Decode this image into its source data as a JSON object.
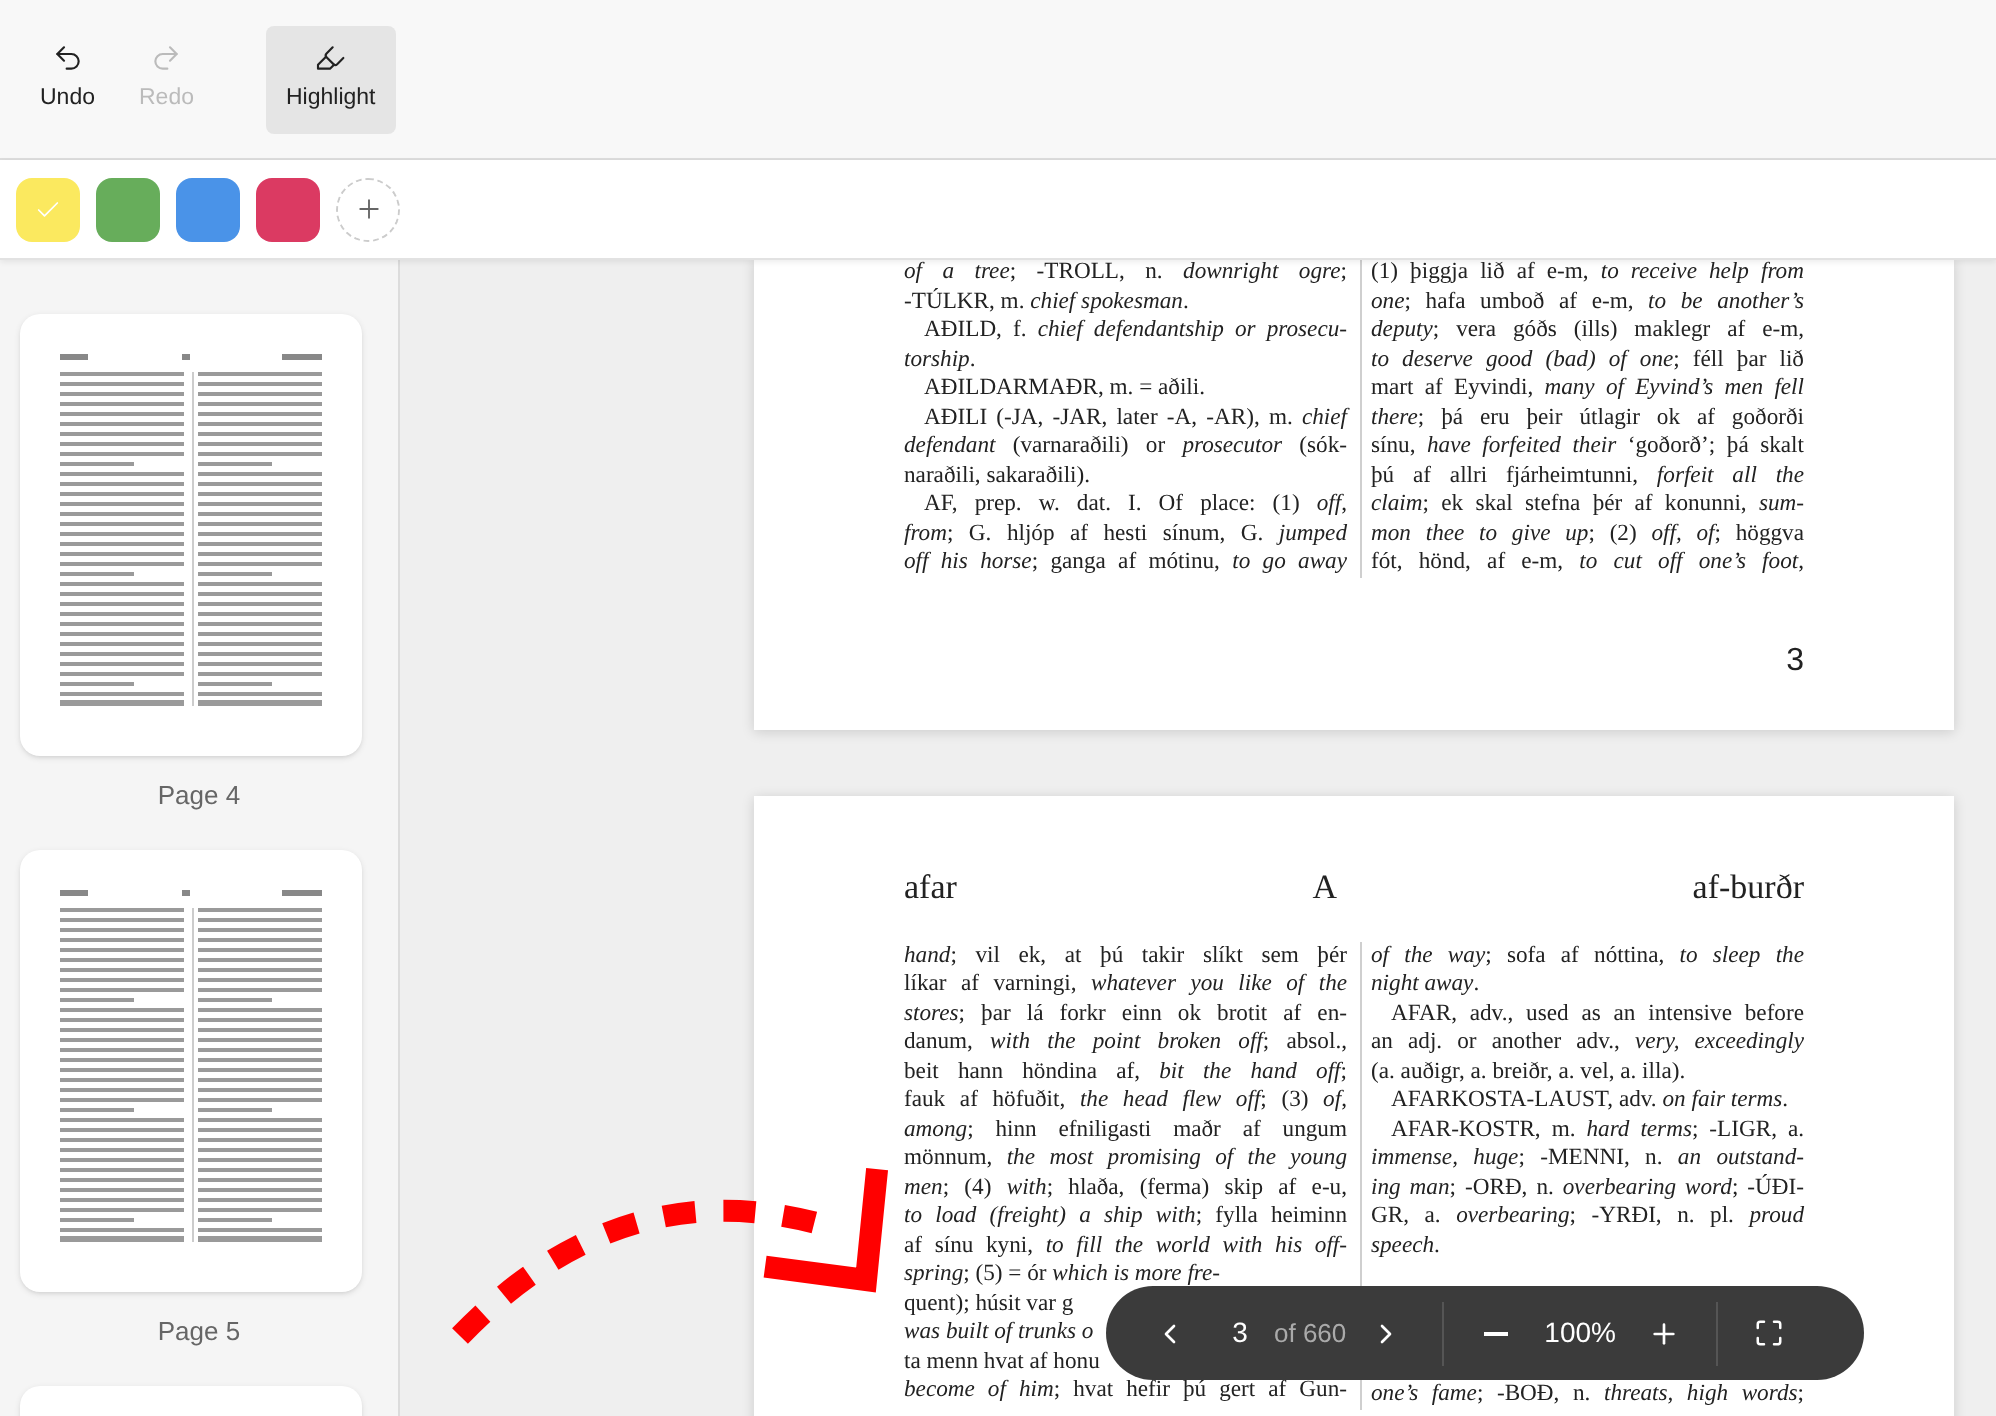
{
  "toolbar": {
    "buttons": [
      {
        "label": "Undo",
        "kind": "undo",
        "disabled": false,
        "selected": false
      },
      {
        "label": "Redo",
        "kind": "redo",
        "disabled": true,
        "selected": false
      },
      {
        "label": "Highlight",
        "kind": "highlight",
        "disabled": false,
        "selected": true
      }
    ]
  },
  "palette": {
    "colors": [
      {
        "color": "#fbe95f",
        "selected": true
      },
      {
        "color": "#67ad5b",
        "selected": false
      },
      {
        "color": "#4a93e8",
        "selected": false
      },
      {
        "color": "#db3a62",
        "selected": false
      }
    ]
  },
  "sidebar": {
    "thumbnails": [
      {
        "label": "Page 4"
      },
      {
        "label": "Page 5"
      }
    ]
  },
  "pages": [
    {
      "page_number": "3",
      "columns": [
        [
          {
            "text": "*of a tree*; -TROLL, n. *downright ogre*;",
            "kind": "line"
          },
          {
            "text": "-TÚLKR, m. *chief spokesman*.",
            "kind": "last"
          },
          {
            "text": "AÐILD, f. *chief defendantship or prosecu-*",
            "kind": "first"
          },
          {
            "text": "*torship*.",
            "kind": "last"
          },
          {
            "text": "AÐILDARMAÐR, m. = aðili.",
            "kind": "single"
          },
          {
            "text": "AÐILI (-JA, -JAR, later -A, -AR), m. *chief*",
            "kind": "first"
          },
          {
            "text": "*defendant* (varnaraðili) or *prosecutor* (sók-",
            "kind": "line"
          },
          {
            "text": "naraðili, sakaraðili).",
            "kind": "last"
          },
          {
            "text": "AF, prep. w. dat. I. Of place: (1) *off*,",
            "kind": "first"
          },
          {
            "text": "*from*; G. hljóp af hesti sínum, G. *jumped*",
            "kind": "line"
          },
          {
            "text": "*off his horse*; ganga af mótinu, *to go away*",
            "kind": "line"
          }
        ],
        [
          {
            "text": "(1) þiggja lið af e-m, *to receive help from*",
            "kind": "line"
          },
          {
            "text": "*one*; hafa umboð af e-m, *to be another’s*",
            "kind": "line"
          },
          {
            "text": "*deputy*; vera góðs (ills) maklegr af e-m,",
            "kind": "line"
          },
          {
            "text": "*to deserve good (bad) of one*; féll þar lið",
            "kind": "line"
          },
          {
            "text": "mart af Eyvindi, *many of Eyvind’s men fell*",
            "kind": "line"
          },
          {
            "text": "*there*; þá eru þeir útlagir ok af goðorði",
            "kind": "line"
          },
          {
            "text": "sínu, *have forfeited their* ‘goðorð’; þá skalt",
            "kind": "line"
          },
          {
            "text": "þú af allri fjárheimtunni, *forfeit all the*",
            "kind": "line"
          },
          {
            "text": "*claim*; ek skal stefna þér af konunni, *sum-*",
            "kind": "line"
          },
          {
            "text": "*mon thee to give up*; (2) *off, of*; höggva",
            "kind": "line"
          },
          {
            "text": "fót, hönd, af e-m, *to cut off one’s foot*,",
            "kind": "line"
          }
        ]
      ]
    },
    {
      "header": {
        "left": "afar",
        "center": "A",
        "right": "af-burðr"
      },
      "columns": [
        [
          {
            "text": "*hand*; vil ek, at þú takir slíkt sem þér",
            "kind": "line"
          },
          {
            "text": "líkar af varningi, *whatever you like of the*",
            "kind": "line"
          },
          {
            "text": "*stores*; þar lá forkr einn ok brotit af en-",
            "kind": "line"
          },
          {
            "text": "danum, *with the point broken off*; absol.,",
            "kind": "line"
          },
          {
            "text": "beit hann höndina af, *bit the hand off*;",
            "kind": "line"
          },
          {
            "text": "fauk af höfuðit, *the head flew off*; (3) *of*,",
            "kind": "line"
          },
          {
            "text": "*among*; hinn efniligasti maðr af ungum",
            "kind": "line"
          },
          {
            "text": "mönnum, *the most promising of the young*",
            "kind": "line"
          },
          {
            "text": "*men*; (4) *with*; hlaða, (ferma) skip af e-u,",
            "kind": "line"
          },
          {
            "text": "*to load (freight) a ship with*; fylla heiminn",
            "kind": "line"
          },
          {
            "text": "af sínu kyni, *to fill the world with his off-*",
            "kind": "line"
          },
          {
            "text": "*spring*; (5) = ór *which is more fre-*",
            "kind": "last"
          },
          {
            "text": "quent); húsit var g",
            "kind": "last"
          },
          {
            "text": "*was built of trunks o*",
            "kind": "last"
          },
          {
            "text": "ta menn hvat af honu",
            "kind": "last"
          },
          {
            "text": "*become of him*; hvat hefir þú gert af Gun-",
            "kind": "line"
          }
        ],
        [
          {
            "text": "*of the way*; sofa af nóttina, *to sleep the*",
            "kind": "line"
          },
          {
            "text": "*night away*.",
            "kind": "last"
          },
          {
            "text": "AFAR, adv., used as an intensive before",
            "kind": "first"
          },
          {
            "text": "an adj. or another adv., *very, exceedingly*",
            "kind": "line"
          },
          {
            "text": "(a. auðigr, a. breiðr, a. vel, a. illa).",
            "kind": "last"
          },
          {
            "text": "AFARKOSTA-LAUST, adv. *on fair terms*.",
            "kind": "single"
          },
          {
            "text": "AFAR-KOSTR, m. *hard terms*; -LIGR, a.",
            "kind": "first"
          },
          {
            "text": "*immense, huge*; -MENNI, n. *an outstand-*",
            "kind": "line"
          },
          {
            "text": "*ing man*; -ORÐ, n. *overbearing word*; -ÚÐI-",
            "kind": "line"
          },
          {
            "text": "GR, a. *overbearing*; -YRÐI, n. pl. *proud*",
            "kind": "line"
          },
          {
            "text": "*speech*.",
            "kind": "last"
          },
          {
            "text": "*one’s fame*; -BOÐ, n. *threats, high words*;",
            "kind": "bottom"
          }
        ]
      ]
    }
  ],
  "pager": {
    "current": "3",
    "total": "of 660",
    "zoom": "100%"
  }
}
